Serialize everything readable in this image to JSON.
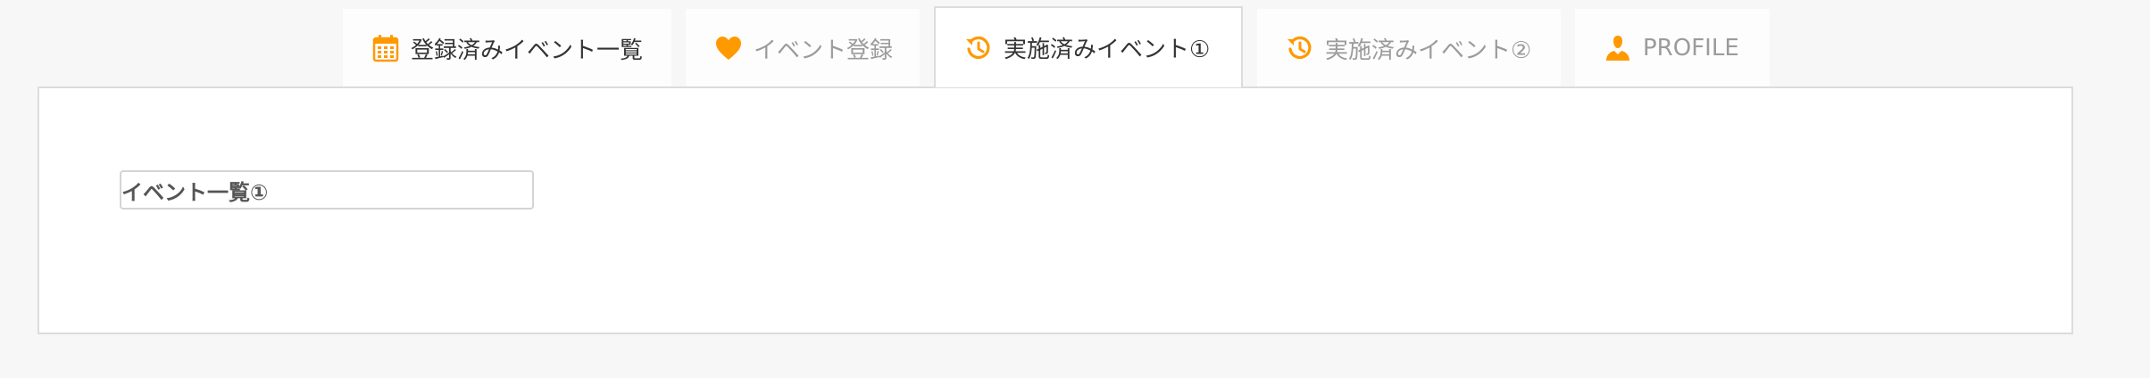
{
  "tabs": [
    {
      "label": "登録済みイベント一覧",
      "icon": "calendar-icon",
      "active": false
    },
    {
      "label": "イベント登録",
      "icon": "heart-icon",
      "active": false
    },
    {
      "label": "実施済みイベント①",
      "icon": "history-icon",
      "active": true
    },
    {
      "label": "実施済みイベント②",
      "icon": "history-icon",
      "active": false
    },
    {
      "label": "PROFILE",
      "icon": "user-icon",
      "active": false
    }
  ],
  "panel": {
    "field_value": "イベント一覧①"
  },
  "colors": {
    "accent": "#ff9900",
    "active_text": "#333333",
    "inactive_text": "#9b9b9b",
    "border": "#dcdcdc",
    "background": "#f7f7f7"
  }
}
